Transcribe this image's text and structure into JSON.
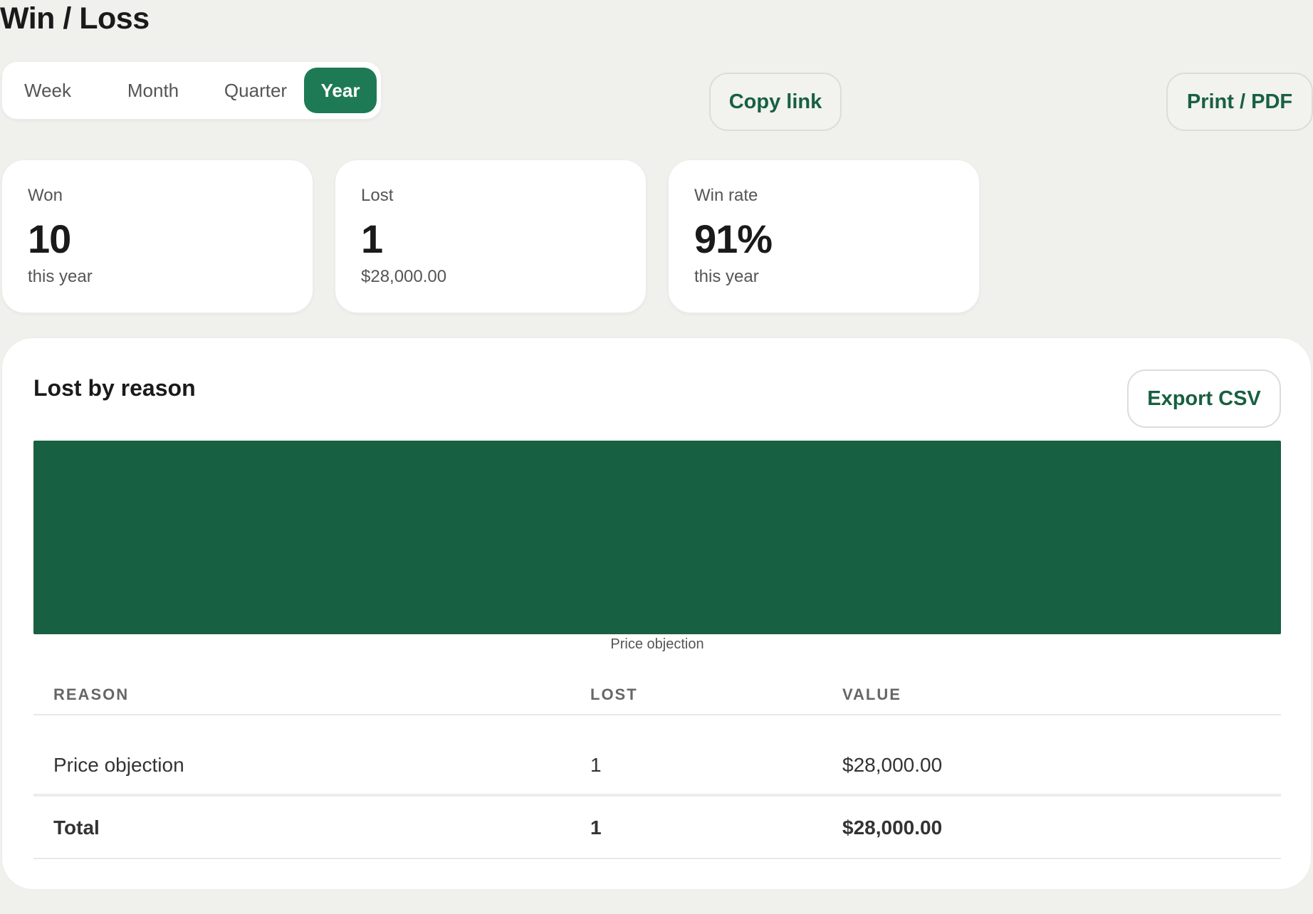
{
  "page": {
    "title": "Win / Loss"
  },
  "period_tabs": [
    {
      "label": "Week",
      "active": false
    },
    {
      "label": "Month",
      "active": false
    },
    {
      "label": "Quarter",
      "active": false
    },
    {
      "label": "Year",
      "active": true
    }
  ],
  "toolbar": {
    "copy_link_label": "Copy link",
    "print_label": "Print / PDF"
  },
  "stats": {
    "won": {
      "label": "Won",
      "value": "10",
      "sub": "this year"
    },
    "lost": {
      "label": "Lost",
      "value": "1",
      "sub": "$28,000.00"
    },
    "win_rate": {
      "label": "Win rate",
      "value": "91%",
      "sub": "this year"
    }
  },
  "lost_by_reason": {
    "title": "Lost by reason",
    "export_label": "Export CSV",
    "table": {
      "headers": [
        "REASON",
        "LOST",
        "VALUE"
      ],
      "rows": [
        {
          "reason": "Price objection",
          "lost": "1",
          "value": "$28,000.00"
        }
      ],
      "total": {
        "label": "Total",
        "lost": "1",
        "value": "$28,000.00"
      }
    }
  },
  "colors": {
    "accent": "#1e7a55",
    "bar": "#176042",
    "background": "#f0f0ec"
  },
  "chart_data": {
    "type": "bar",
    "categories": [
      "Price objection"
    ],
    "values": [
      1
    ],
    "title": "",
    "xlabel": "",
    "ylabel": "",
    "ylim": [
      0,
      1
    ]
  }
}
